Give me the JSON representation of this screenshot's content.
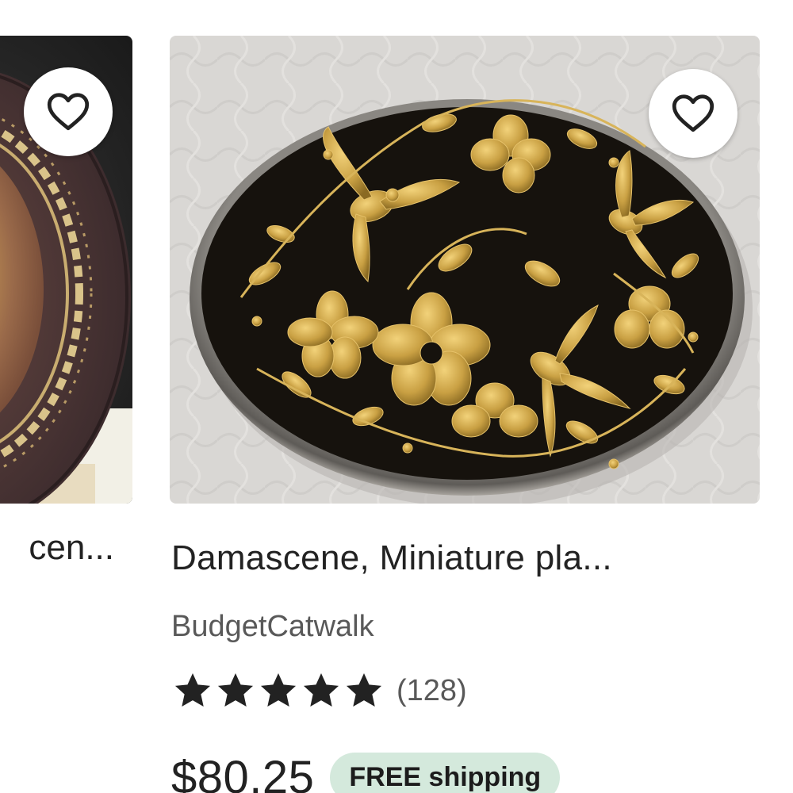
{
  "listings": [
    {
      "title": "Damascene plate, ornate ... Damascen...",
      "title_visible": "cen...",
      "image_icon": "ornate-brown-plate-image",
      "favorite_icon": "heart-outline-icon"
    },
    {
      "title": "Damascene, Miniature pla...",
      "shop": "BudgetCatwalk",
      "rating": 5,
      "stars_icon": "star-icon",
      "review_count": "(128)",
      "price": "$80.25",
      "shipping_badge": "FREE shipping",
      "image_icon": "damascene-gold-bird-plate-image",
      "favorite_icon": "heart-outline-icon"
    }
  ],
  "colors": {
    "text_primary": "#222222",
    "text_secondary": "#595959",
    "shipping_badge_bg": "#d4e9dc",
    "favorite_button_bg": "#ffffff"
  }
}
